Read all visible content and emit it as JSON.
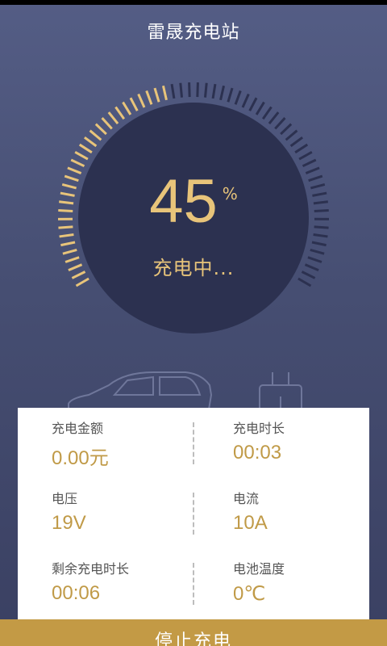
{
  "header": {
    "title": "雷晟充电站"
  },
  "gauge": {
    "percent": "45",
    "percent_unit": "%",
    "progress_fraction": 0.45,
    "status": "充电中..."
  },
  "info": {
    "rows": [
      {
        "left": {
          "label": "充电金额",
          "value": "0.00元"
        },
        "right": {
          "label": "充电时长",
          "value": "00:03"
        }
      },
      {
        "left": {
          "label": "电压",
          "value": "19V"
        },
        "right": {
          "label": "电流",
          "value": "10A"
        }
      },
      {
        "left": {
          "label": "剩余充电时长",
          "value": "00:06"
        },
        "right": {
          "label": "电池温度",
          "value": "0℃"
        }
      }
    ]
  },
  "footer": {
    "stop_label": "停止充电"
  },
  "colors": {
    "accent": "#c39a45",
    "progress": "#e8c47a",
    "track": "#2c3150",
    "background": "#4a5276"
  }
}
